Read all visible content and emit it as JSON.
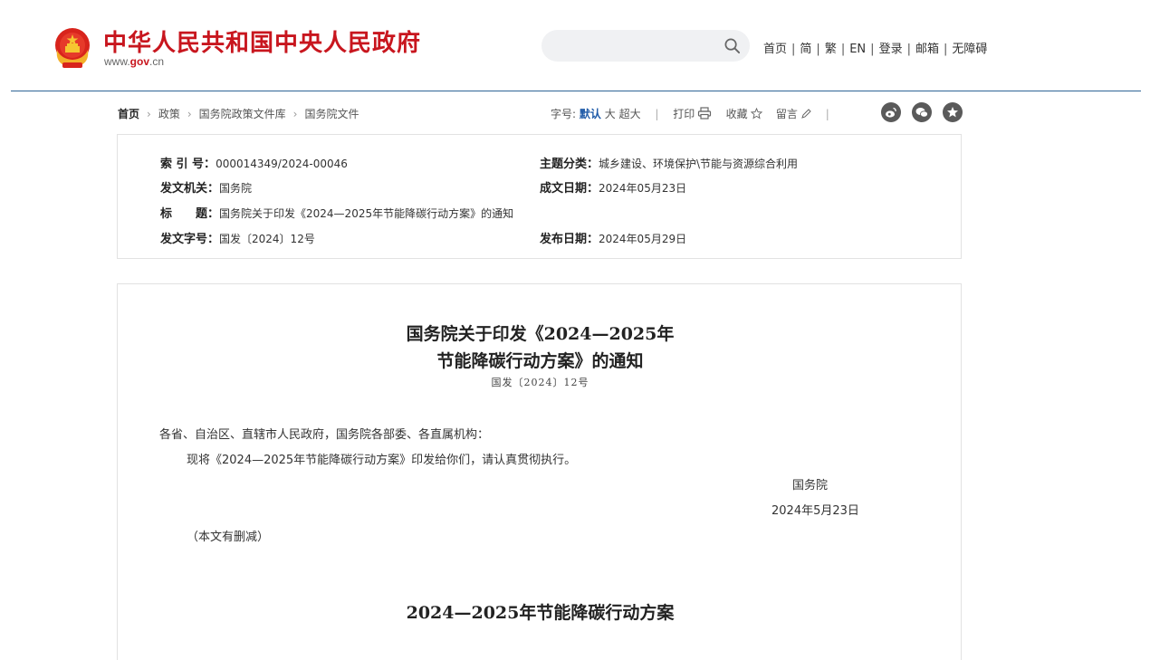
{
  "header": {
    "title": "中华人民共和国中央人民政府",
    "url_prefix": "www.",
    "url_domain": "gov",
    "url_suffix": ".cn",
    "search_placeholder": "",
    "nav": [
      "首页",
      "简",
      "繁",
      "EN",
      "登录",
      "邮箱",
      "无障碍"
    ],
    "brand_color": "#c8161e",
    "accent_color": "#2f6496"
  },
  "breadcrumb": {
    "items": [
      "首页",
      "政策",
      "国务院政策文件库",
      "国务院文件"
    ]
  },
  "tools": {
    "font_label": "字号:",
    "font_default": "默认",
    "font_large": "大",
    "font_xlarge": "超大",
    "print": "打印",
    "favorite": "收藏",
    "comment": "留言",
    "share_icons": [
      "weibo-icon",
      "wechat-icon",
      "favorite-star-icon"
    ]
  },
  "meta": {
    "index_label": "索 引 号：",
    "index_value": "000014349/2024-00046",
    "category_label": "主题分类：",
    "category_value": "城乡建设、环境保护\\节能与资源综合利用",
    "issuer_label": "发文机关：",
    "issuer_value": "国务院",
    "written_label": "成文日期：",
    "written_value": "2024年05月23日",
    "title_label": "标　　题：",
    "title_value": "国务院关于印发《2024—2025年节能降碳行动方案》的通知",
    "docno_label": "发文字号：",
    "docno_value": "国发〔2024〕12号",
    "published_label": "发布日期：",
    "published_value": "2024年05月29日"
  },
  "article": {
    "title_line1": "国务院关于印发《2024—2025年",
    "title_line2": "节能降碳行动方案》的通知",
    "doc_number": "国发〔2024〕12号",
    "salutation": "各省、自治区、直辖市人民政府，国务院各部委、各直属机构：",
    "body": "现将《2024—2025年节能降碳行动方案》印发给你们，请认真贯彻执行。",
    "signature": "国务院",
    "date": "2024年5月23日",
    "note": "（本文有删减）",
    "section_title": "2024—2025年节能降碳行动方案"
  }
}
